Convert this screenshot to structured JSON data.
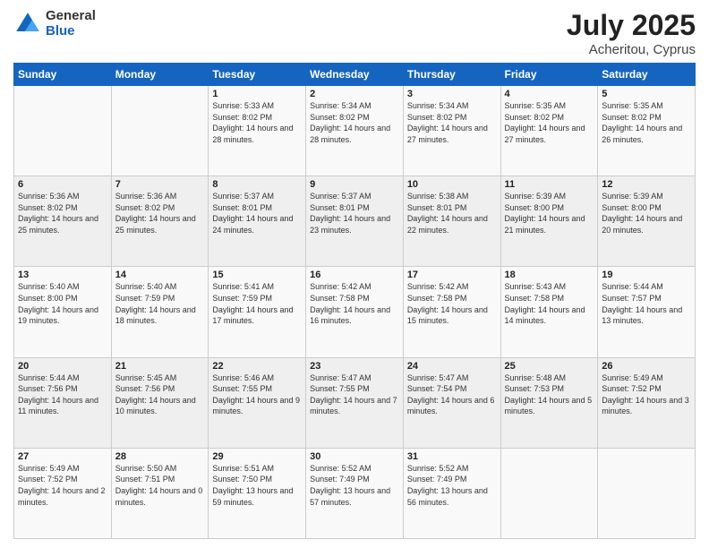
{
  "header": {
    "logo_general": "General",
    "logo_blue": "Blue",
    "title": "July 2025",
    "location": "Acheritou, Cyprus"
  },
  "weekdays": [
    "Sunday",
    "Monday",
    "Tuesday",
    "Wednesday",
    "Thursday",
    "Friday",
    "Saturday"
  ],
  "weeks": [
    [
      {
        "day": "",
        "sunrise": "",
        "sunset": "",
        "daylight": ""
      },
      {
        "day": "",
        "sunrise": "",
        "sunset": "",
        "daylight": ""
      },
      {
        "day": "1",
        "sunrise": "Sunrise: 5:33 AM",
        "sunset": "Sunset: 8:02 PM",
        "daylight": "Daylight: 14 hours and 28 minutes."
      },
      {
        "day": "2",
        "sunrise": "Sunrise: 5:34 AM",
        "sunset": "Sunset: 8:02 PM",
        "daylight": "Daylight: 14 hours and 28 minutes."
      },
      {
        "day": "3",
        "sunrise": "Sunrise: 5:34 AM",
        "sunset": "Sunset: 8:02 PM",
        "daylight": "Daylight: 14 hours and 27 minutes."
      },
      {
        "day": "4",
        "sunrise": "Sunrise: 5:35 AM",
        "sunset": "Sunset: 8:02 PM",
        "daylight": "Daylight: 14 hours and 27 minutes."
      },
      {
        "day": "5",
        "sunrise": "Sunrise: 5:35 AM",
        "sunset": "Sunset: 8:02 PM",
        "daylight": "Daylight: 14 hours and 26 minutes."
      }
    ],
    [
      {
        "day": "6",
        "sunrise": "Sunrise: 5:36 AM",
        "sunset": "Sunset: 8:02 PM",
        "daylight": "Daylight: 14 hours and 25 minutes."
      },
      {
        "day": "7",
        "sunrise": "Sunrise: 5:36 AM",
        "sunset": "Sunset: 8:02 PM",
        "daylight": "Daylight: 14 hours and 25 minutes."
      },
      {
        "day": "8",
        "sunrise": "Sunrise: 5:37 AM",
        "sunset": "Sunset: 8:01 PM",
        "daylight": "Daylight: 14 hours and 24 minutes."
      },
      {
        "day": "9",
        "sunrise": "Sunrise: 5:37 AM",
        "sunset": "Sunset: 8:01 PM",
        "daylight": "Daylight: 14 hours and 23 minutes."
      },
      {
        "day": "10",
        "sunrise": "Sunrise: 5:38 AM",
        "sunset": "Sunset: 8:01 PM",
        "daylight": "Daylight: 14 hours and 22 minutes."
      },
      {
        "day": "11",
        "sunrise": "Sunrise: 5:39 AM",
        "sunset": "Sunset: 8:00 PM",
        "daylight": "Daylight: 14 hours and 21 minutes."
      },
      {
        "day": "12",
        "sunrise": "Sunrise: 5:39 AM",
        "sunset": "Sunset: 8:00 PM",
        "daylight": "Daylight: 14 hours and 20 minutes."
      }
    ],
    [
      {
        "day": "13",
        "sunrise": "Sunrise: 5:40 AM",
        "sunset": "Sunset: 8:00 PM",
        "daylight": "Daylight: 14 hours and 19 minutes."
      },
      {
        "day": "14",
        "sunrise": "Sunrise: 5:40 AM",
        "sunset": "Sunset: 7:59 PM",
        "daylight": "Daylight: 14 hours and 18 minutes."
      },
      {
        "day": "15",
        "sunrise": "Sunrise: 5:41 AM",
        "sunset": "Sunset: 7:59 PM",
        "daylight": "Daylight: 14 hours and 17 minutes."
      },
      {
        "day": "16",
        "sunrise": "Sunrise: 5:42 AM",
        "sunset": "Sunset: 7:58 PM",
        "daylight": "Daylight: 14 hours and 16 minutes."
      },
      {
        "day": "17",
        "sunrise": "Sunrise: 5:42 AM",
        "sunset": "Sunset: 7:58 PM",
        "daylight": "Daylight: 14 hours and 15 minutes."
      },
      {
        "day": "18",
        "sunrise": "Sunrise: 5:43 AM",
        "sunset": "Sunset: 7:58 PM",
        "daylight": "Daylight: 14 hours and 14 minutes."
      },
      {
        "day": "19",
        "sunrise": "Sunrise: 5:44 AM",
        "sunset": "Sunset: 7:57 PM",
        "daylight": "Daylight: 14 hours and 13 minutes."
      }
    ],
    [
      {
        "day": "20",
        "sunrise": "Sunrise: 5:44 AM",
        "sunset": "Sunset: 7:56 PM",
        "daylight": "Daylight: 14 hours and 11 minutes."
      },
      {
        "day": "21",
        "sunrise": "Sunrise: 5:45 AM",
        "sunset": "Sunset: 7:56 PM",
        "daylight": "Daylight: 14 hours and 10 minutes."
      },
      {
        "day": "22",
        "sunrise": "Sunrise: 5:46 AM",
        "sunset": "Sunset: 7:55 PM",
        "daylight": "Daylight: 14 hours and 9 minutes."
      },
      {
        "day": "23",
        "sunrise": "Sunrise: 5:47 AM",
        "sunset": "Sunset: 7:55 PM",
        "daylight": "Daylight: 14 hours and 7 minutes."
      },
      {
        "day": "24",
        "sunrise": "Sunrise: 5:47 AM",
        "sunset": "Sunset: 7:54 PM",
        "daylight": "Daylight: 14 hours and 6 minutes."
      },
      {
        "day": "25",
        "sunrise": "Sunrise: 5:48 AM",
        "sunset": "Sunset: 7:53 PM",
        "daylight": "Daylight: 14 hours and 5 minutes."
      },
      {
        "day": "26",
        "sunrise": "Sunrise: 5:49 AM",
        "sunset": "Sunset: 7:52 PM",
        "daylight": "Daylight: 14 hours and 3 minutes."
      }
    ],
    [
      {
        "day": "27",
        "sunrise": "Sunrise: 5:49 AM",
        "sunset": "Sunset: 7:52 PM",
        "daylight": "Daylight: 14 hours and 2 minutes."
      },
      {
        "day": "28",
        "sunrise": "Sunrise: 5:50 AM",
        "sunset": "Sunset: 7:51 PM",
        "daylight": "Daylight: 14 hours and 0 minutes."
      },
      {
        "day": "29",
        "sunrise": "Sunrise: 5:51 AM",
        "sunset": "Sunset: 7:50 PM",
        "daylight": "Daylight: 13 hours and 59 minutes."
      },
      {
        "day": "30",
        "sunrise": "Sunrise: 5:52 AM",
        "sunset": "Sunset: 7:49 PM",
        "daylight": "Daylight: 13 hours and 57 minutes."
      },
      {
        "day": "31",
        "sunrise": "Sunrise: 5:52 AM",
        "sunset": "Sunset: 7:49 PM",
        "daylight": "Daylight: 13 hours and 56 minutes."
      },
      {
        "day": "",
        "sunrise": "",
        "sunset": "",
        "daylight": ""
      },
      {
        "day": "",
        "sunrise": "",
        "sunset": "",
        "daylight": ""
      }
    ]
  ]
}
